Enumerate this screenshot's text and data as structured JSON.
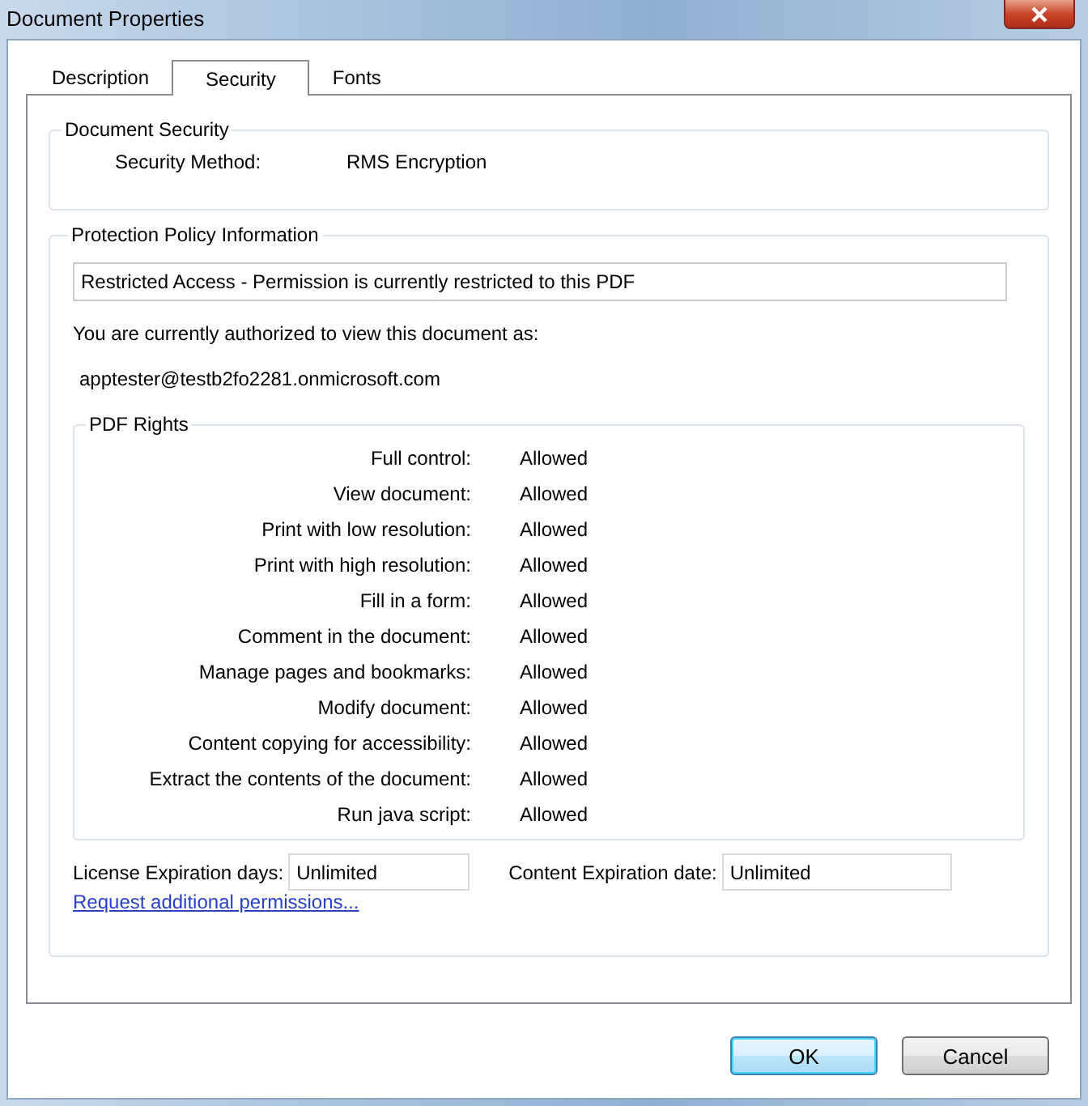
{
  "window": {
    "title": "Document Properties"
  },
  "tabs": [
    {
      "label": "Description",
      "selected": false
    },
    {
      "label": "Security",
      "selected": true
    },
    {
      "label": "Fonts",
      "selected": false
    }
  ],
  "document_security": {
    "title": "Document Security",
    "label": "Security Method:",
    "value": "RMS Encryption"
  },
  "protection_policy": {
    "title": "Protection Policy Information",
    "status": "Restricted Access - Permission is currently restricted to this PDF",
    "authorized_text": "You are currently authorized to view this document as:",
    "user": "apptester@testb2fo2281.onmicrosoft.com",
    "pdf_rights": {
      "title": "PDF Rights",
      "rows": [
        {
          "label": "Full control:",
          "value": "Allowed"
        },
        {
          "label": "View document:",
          "value": "Allowed"
        },
        {
          "label": "Print with low resolution:",
          "value": "Allowed"
        },
        {
          "label": "Print with high resolution:",
          "value": "Allowed"
        },
        {
          "label": "Fill in a form:",
          "value": "Allowed"
        },
        {
          "label": "Comment in the document:",
          "value": "Allowed"
        },
        {
          "label": "Manage pages and bookmarks:",
          "value": "Allowed"
        },
        {
          "label": "Modify document:",
          "value": "Allowed"
        },
        {
          "label": "Content copying for accessibility:",
          "value": "Allowed"
        },
        {
          "label": "Extract the contents of the document:",
          "value": "Allowed"
        },
        {
          "label": "Run java script:",
          "value": "Allowed"
        }
      ]
    },
    "license_expiration": {
      "label": "License Expiration days:",
      "value": "Unlimited"
    },
    "content_expiration": {
      "label": "Content Expiration date:",
      "value": "Unlimited"
    },
    "link": "Request additional permissions..."
  },
  "buttons": [
    {
      "label": "OK",
      "default": true
    },
    {
      "label": "Cancel",
      "default": false
    }
  ]
}
